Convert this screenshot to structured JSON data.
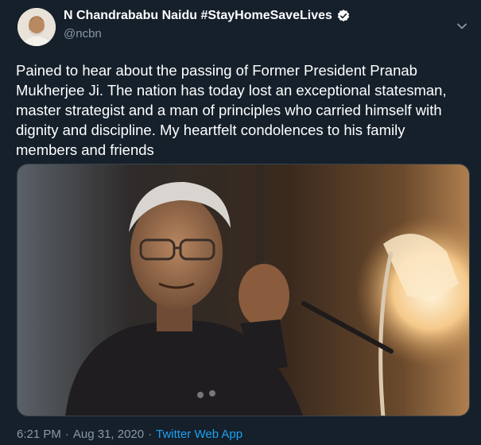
{
  "tweet": {
    "author_name": "N Chandrababu Naidu #StayHomeSaveLives",
    "handle": "@ncbn",
    "text": "Pained to hear about the passing of Former President Pranab Mukherjee Ji. The nation has today lost an exceptional statesman, master strategist and a man of principles who carried himself with dignity and discipline. My heartfelt condolences to his family members and friends",
    "time": "6:21 PM",
    "date": "Aug 31, 2020",
    "separator": "·",
    "source": "Twitter Web App"
  },
  "colors": {
    "background": "#15202b",
    "secondary_text": "#8899a6",
    "link": "#1da1f2",
    "verified_badge": "#ffffff"
  },
  "icons": {
    "verified": "verified-badge-icon",
    "menu": "chevron-down-icon"
  }
}
